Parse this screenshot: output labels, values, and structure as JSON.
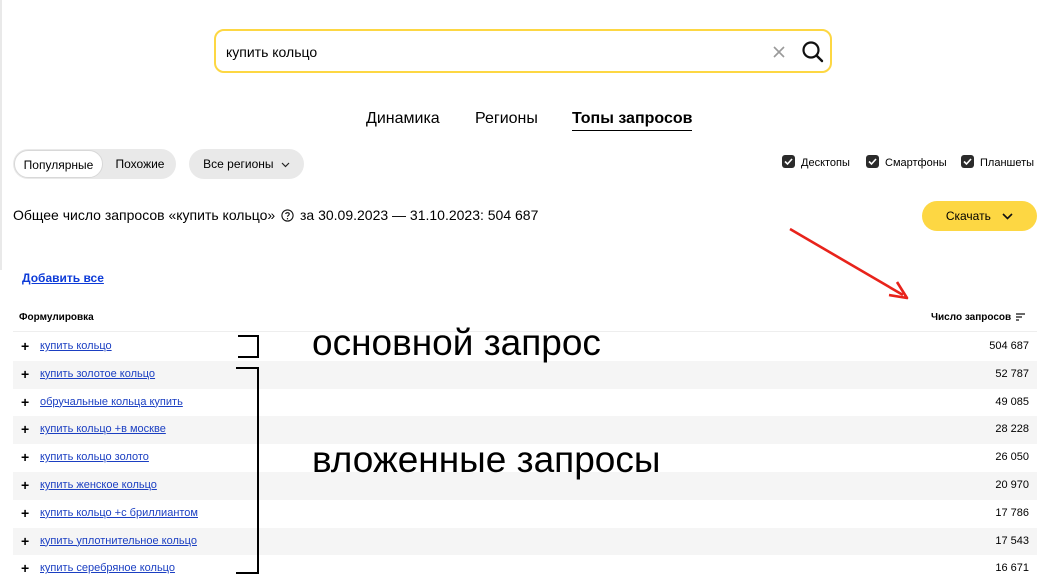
{
  "search": {
    "value": "купить кольцо"
  },
  "tabs": [
    {
      "label": "Динамика",
      "active": false
    },
    {
      "label": "Регионы",
      "active": false
    },
    {
      "label": "Топы запросов",
      "active": true
    }
  ],
  "filters": {
    "segments": [
      {
        "label": "Популярные",
        "selected": true
      },
      {
        "label": "Похожие",
        "selected": false
      }
    ],
    "region_label": "Все регионы",
    "devices": [
      {
        "label": "Десктопы",
        "checked": true
      },
      {
        "label": "Смартфоны",
        "checked": true
      },
      {
        "label": "Планшеты",
        "checked": true
      }
    ]
  },
  "summary": {
    "prefix": "Общее число запросов «купить кольцо»",
    "suffix": "за 30.09.2023 — 31.10.2023: 504 687"
  },
  "download_label": "Скачать",
  "add_all_label": "Добавить все",
  "table": {
    "col_query": "Формулировка",
    "col_count": "Число запросов",
    "rows": [
      {
        "query": "купить кольцо",
        "count": "504 687"
      },
      {
        "query": "купить золотое кольцо",
        "count": "52 787"
      },
      {
        "query": "обручальные кольца купить",
        "count": "49 085"
      },
      {
        "query": "купить кольцо +в москве",
        "count": "28 228"
      },
      {
        "query": "купить кольцо золото",
        "count": "26 050"
      },
      {
        "query": "купить женское кольцо",
        "count": "20 970"
      },
      {
        "query": "купить кольцо +с бриллиантом",
        "count": "17 786"
      },
      {
        "query": "купить уплотнительное кольцо",
        "count": "17 543"
      },
      {
        "query": "купить серебряное кольцо",
        "count": "16 671"
      }
    ]
  },
  "annotations": {
    "main": "основной запрос",
    "nested": "вложенные запросы"
  },
  "colors": {
    "accent": "#fdd743",
    "link": "#1b3fc2",
    "arrow": "#e8231b"
  }
}
